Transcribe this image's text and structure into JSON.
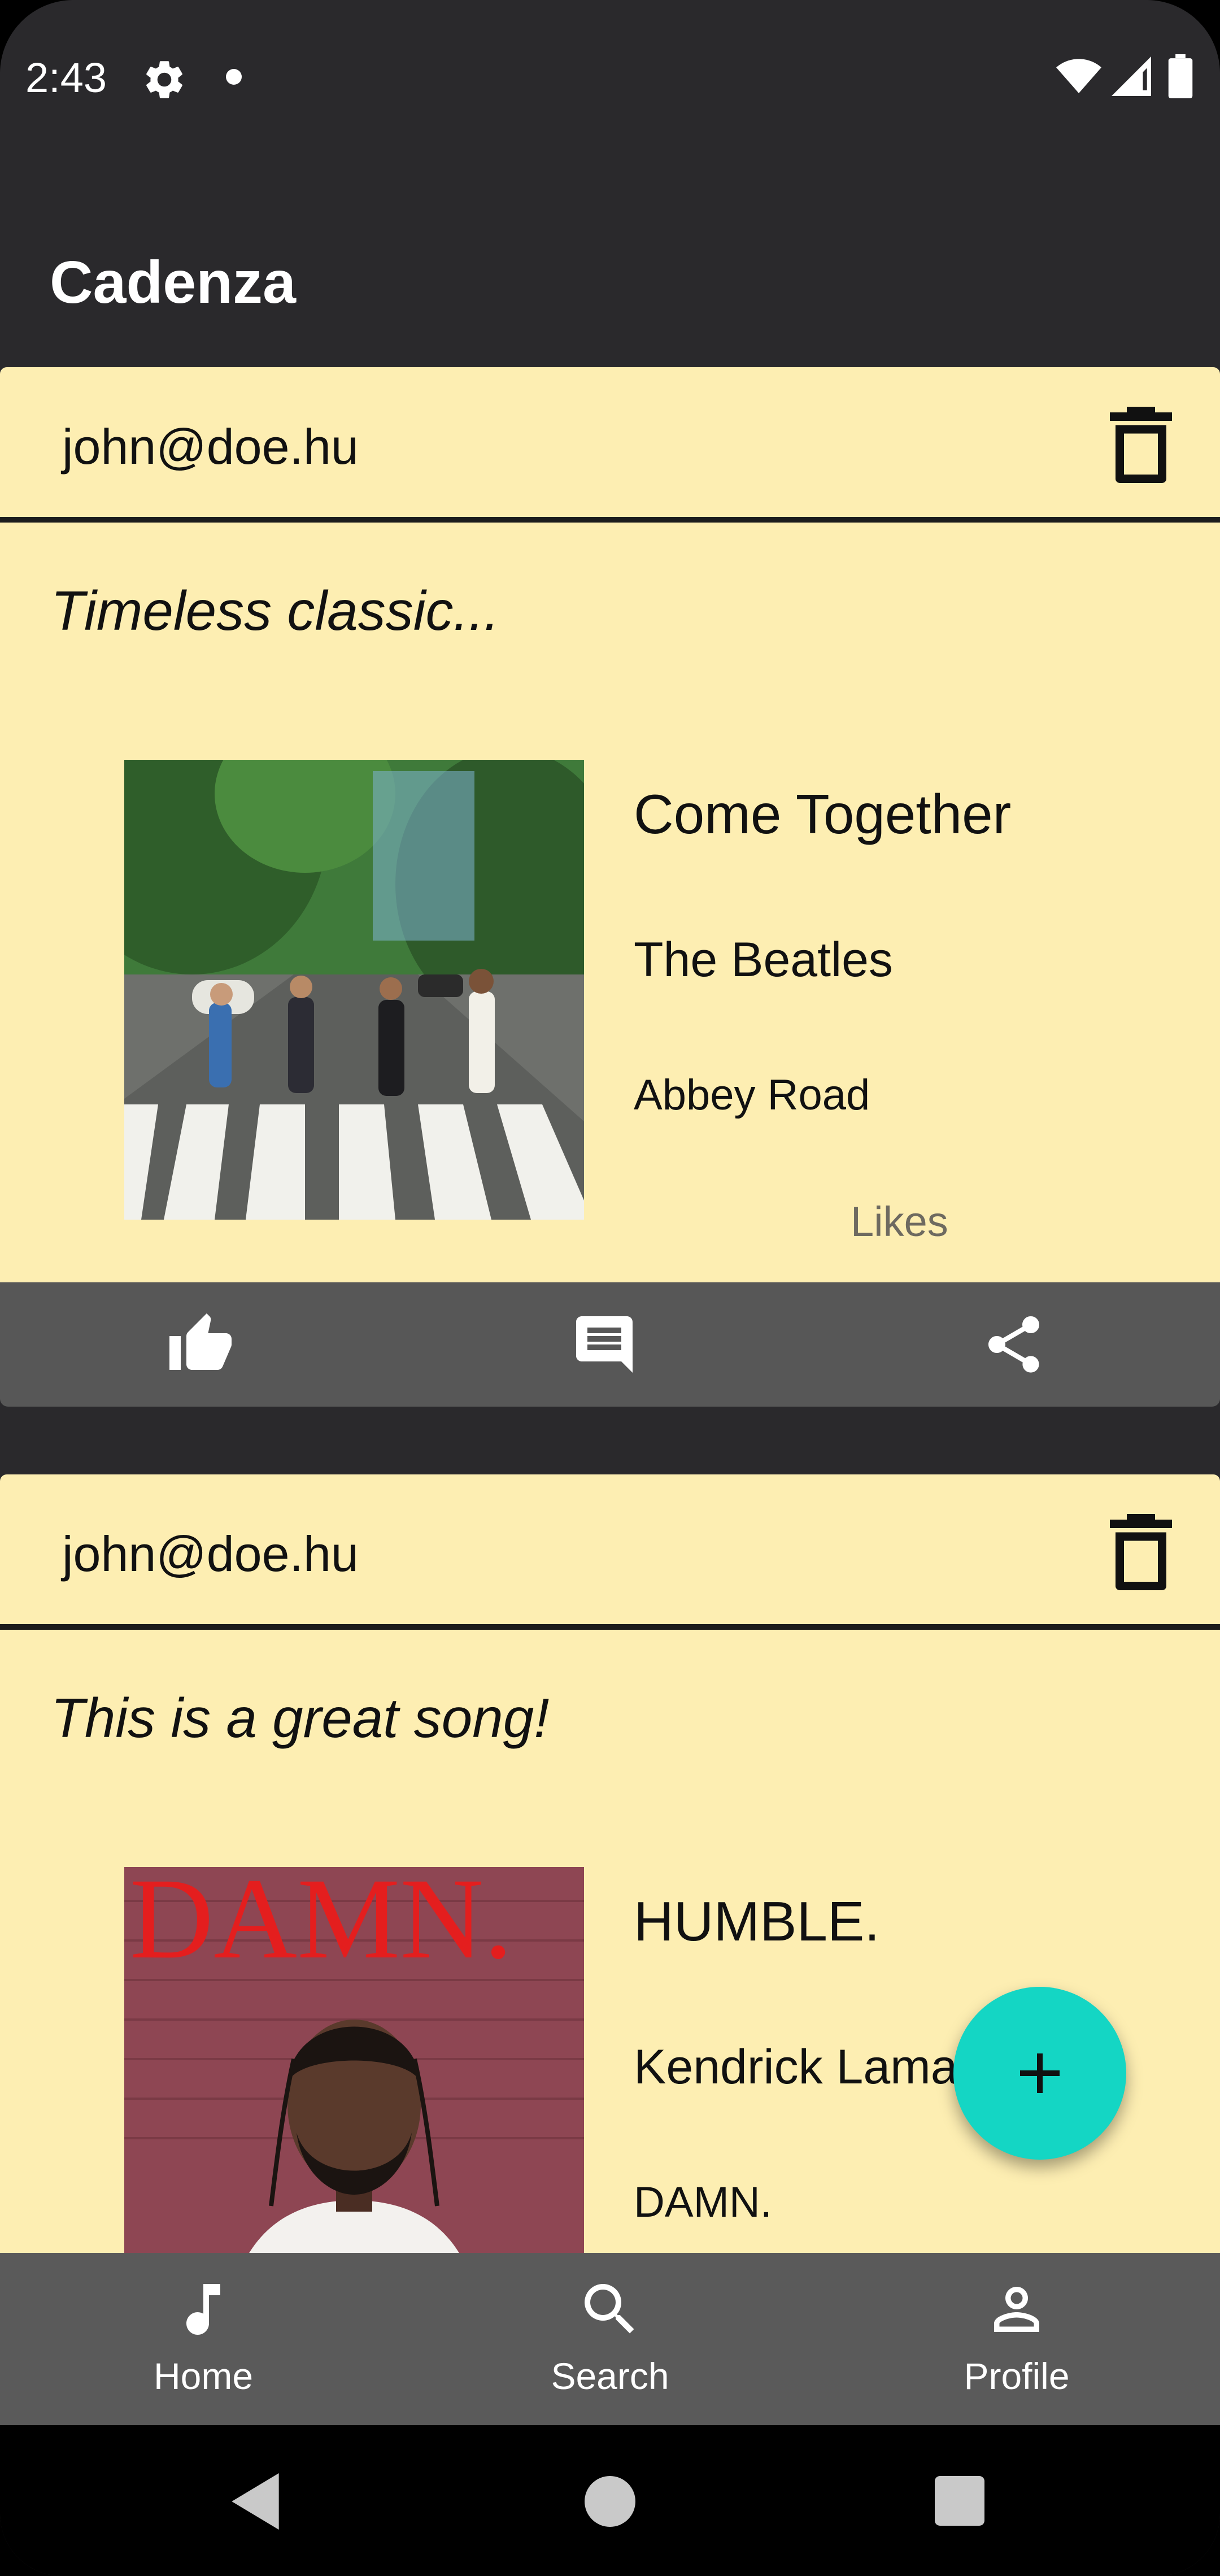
{
  "status_bar": {
    "time": "2:43"
  },
  "app": {
    "title": "Cadenza"
  },
  "posts": [
    {
      "email": "john@doe.hu",
      "comment": "Timeless classic...",
      "song_title": "Come Together",
      "artist": "The Beatles",
      "album": "Abbey Road",
      "likes_label": "Likes",
      "album_art_text": ""
    },
    {
      "email": "john@doe.hu",
      "comment": "This is a great song!",
      "song_title": "HUMBLE.",
      "artist": "Kendrick Lamar",
      "album": "DAMN.",
      "album_art_text": "DAMN."
    }
  ],
  "bottom_nav": [
    {
      "label": "Home",
      "icon": "music-note-icon"
    },
    {
      "label": "Search",
      "icon": "search-icon"
    },
    {
      "label": "Profile",
      "icon": "profile-icon"
    }
  ],
  "colors": {
    "background": "#2a292c",
    "card": "#fdeeb2",
    "action_bar": "#575757",
    "bottom_nav": "#5a5a5a",
    "fab": "#14d6c4"
  }
}
